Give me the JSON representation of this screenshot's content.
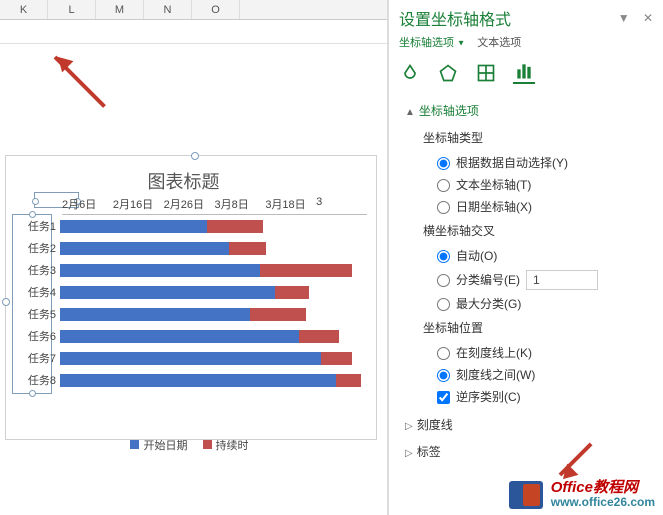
{
  "columns": [
    "K",
    "L",
    "M",
    "N",
    "O"
  ],
  "arrow_color": "#c0392b",
  "chart_data": {
    "type": "bar",
    "title": "图表标题",
    "categories": [
      "任务1",
      "任务2",
      "任务3",
      "任务4",
      "任务5",
      "任务6",
      "任务7",
      "任务8"
    ],
    "x_ticks": [
      "2月6日",
      "2月16日",
      "2月26日",
      "3月8日",
      "3月18日",
      "3"
    ],
    "series": [
      {
        "name": "开始日期",
        "color": "#4472c4",
        "values": [
          48,
          55,
          65,
          70,
          62,
          78,
          85,
          90
        ]
      },
      {
        "name": "持续时",
        "color": "#c0504d",
        "values": [
          18,
          12,
          30,
          11,
          18,
          13,
          10,
          8
        ]
      }
    ],
    "xlabel": "",
    "ylabel": ""
  },
  "pane": {
    "title": "设置坐标轴格式",
    "subtab_axis_options": "坐标轴选项",
    "subtab_text_options": "文本选项",
    "icons": [
      "fill-icon",
      "effects-icon",
      "size-icon",
      "axis-icon"
    ],
    "section_axis_options": "坐标轴选项",
    "group_axis_type": "坐标轴类型",
    "radio_auto_by_data": "根据数据自动选择(Y)",
    "radio_text_axis": "文本坐标轴(T)",
    "radio_date_axis": "日期坐标轴(X)",
    "group_hcross": "横坐标轴交叉",
    "radio_auto": "自动(O)",
    "radio_category_num": "分类编号(E)",
    "category_num_value": "1",
    "radio_max_category": "最大分类(G)",
    "group_axis_position": "坐标轴位置",
    "radio_on_tick": "在刻度线上(K)",
    "radio_between_tick": "刻度线之间(W)",
    "check_reverse": "逆序类别(C)",
    "section_ticks": "刻度线",
    "section_labels": "标签"
  },
  "watermark": {
    "line1a": "Office",
    "line1b": "教程网",
    "line2": "www.office26.com"
  }
}
